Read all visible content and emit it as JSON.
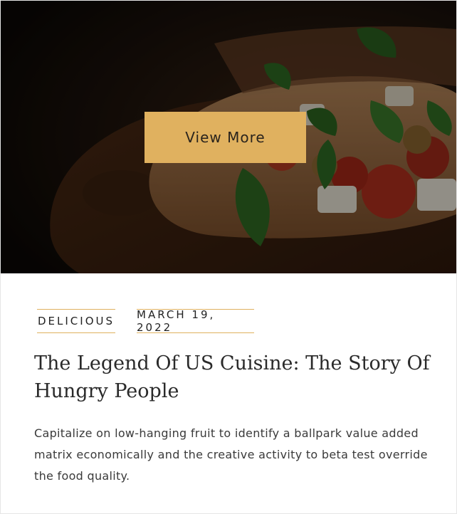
{
  "post": {
    "image_alt": "bruschetta with tomato, basil and mozzarella",
    "view_more_label": "View More",
    "category": "DELICIOUS",
    "date": "MARCH 19, 2022",
    "title": "The Legend Of US Cuisine: The Story Of Hungry People",
    "excerpt": "Capitalize on low-hanging fruit to identify a ballpark value added matrix economically and the creative activity to beta test override the food quality."
  },
  "colors": {
    "accent": "#e0b15f",
    "text": "#2a2a2a",
    "border": "#e6e6e6"
  }
}
